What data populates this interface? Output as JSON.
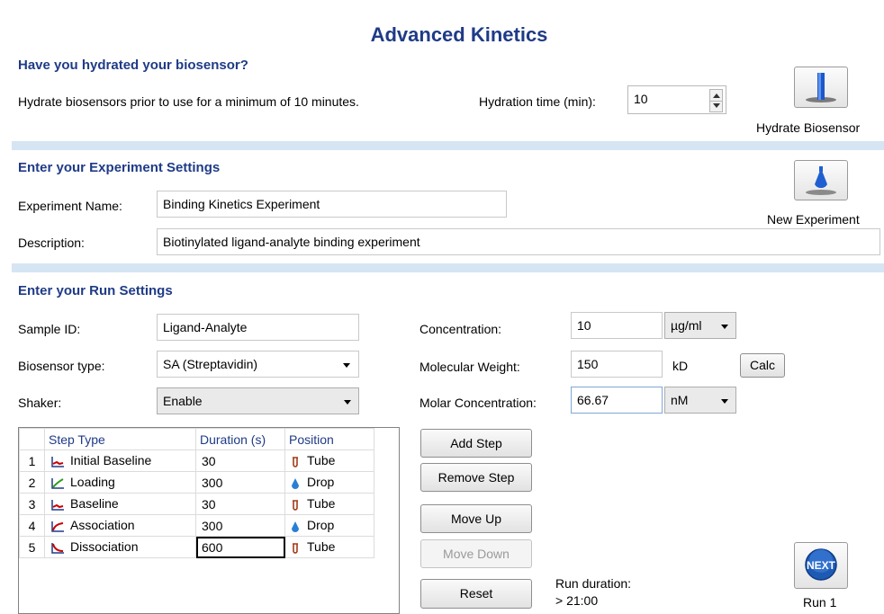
{
  "title": "Advanced Kinetics",
  "hydrate": {
    "heading": "Have you hydrated your biosensor?",
    "note": "Hydrate biosensors prior to use for a minimum of 10 minutes.",
    "time_label": "Hydration time (min):",
    "time_value": "10",
    "button_label": "Hydrate Biosensor"
  },
  "experiment": {
    "heading": "Enter your Experiment Settings",
    "name_label": "Experiment Name:",
    "name_value": "Binding Kinetics Experiment",
    "desc_label": "Description:",
    "desc_value": "Biotinylated ligand-analyte binding experiment",
    "new_button_label": "New Experiment"
  },
  "run": {
    "heading": "Enter your Run Settings",
    "sample_label": "Sample ID:",
    "sample_value": "Ligand-Analyte",
    "biosensor_label": "Biosensor type:",
    "biosensor_value": "SA (Streptavidin)",
    "shaker_label": "Shaker:",
    "shaker_value": "Enable",
    "conc_label": "Concentration:",
    "conc_value": "10",
    "conc_unit": "µg/ml",
    "mw_label": "Molecular Weight:",
    "mw_value": "150",
    "mw_unit": "kD",
    "calc_label": "Calc",
    "molar_label": "Molar Concentration:",
    "molar_value": "66.67",
    "molar_unit": "nM"
  },
  "steps": {
    "headers": [
      "Step Type",
      "Duration (s)",
      "Position"
    ],
    "rows": [
      {
        "num": "1",
        "type": "Initial Baseline",
        "duration": "30",
        "position": "Tube",
        "icon": "baseline-icon",
        "pos_icon": "tube-icon"
      },
      {
        "num": "2",
        "type": "Loading",
        "duration": "300",
        "position": "Drop",
        "icon": "loading-icon",
        "pos_icon": "drop-icon"
      },
      {
        "num": "3",
        "type": "Baseline",
        "duration": "30",
        "position": "Tube",
        "icon": "baseline-icon",
        "pos_icon": "tube-icon"
      },
      {
        "num": "4",
        "type": "Association",
        "duration": "300",
        "position": "Drop",
        "icon": "association-icon",
        "pos_icon": "drop-icon"
      },
      {
        "num": "5",
        "type": "Dissociation",
        "duration": "600",
        "position": "Tube",
        "icon": "dissociation-icon",
        "pos_icon": "tube-icon"
      }
    ]
  },
  "buttons": {
    "add": "Add Step",
    "remove": "Remove Step",
    "move_up": "Move Up",
    "move_down": "Move Down",
    "reset": "Reset"
  },
  "run_duration": {
    "label": "Run duration:",
    "value": "> 21:00"
  },
  "next": {
    "icon_text": "NEXT",
    "label": "Run 1"
  },
  "colors": {
    "heading": "#1f3b87",
    "band": "#d6e5f3",
    "baseline_icon": "#cc0000",
    "loading_icon": "#2e9e1a",
    "drop_icon": "#2a7fd4",
    "next_button": "#1e5ab4"
  }
}
